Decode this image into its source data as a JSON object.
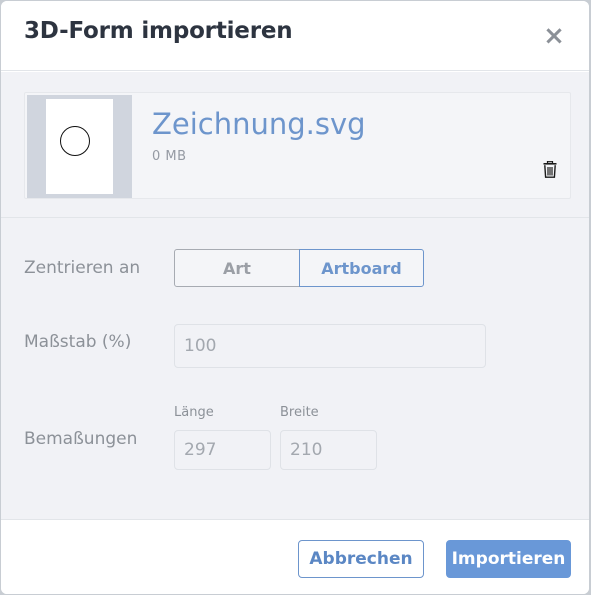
{
  "dialog": {
    "title": "3D-Form importieren",
    "close_icon": "×"
  },
  "file": {
    "name": "Zeichnung.svg",
    "size": "0 MB"
  },
  "options": {
    "center_label": "Zentrieren an",
    "center_options": [
      "Art",
      "Artboard"
    ],
    "center_selected": "Artboard",
    "scale_label": "Maßstab (%)",
    "scale_value": "100",
    "dimensions_label": "Bemaßungen",
    "length_label": "Länge",
    "length_value": "297",
    "width_label": "Breite",
    "width_value": "210"
  },
  "footer": {
    "cancel_label": "Abbrechen",
    "import_label": "Importieren"
  },
  "colors": {
    "accent": "#6d95cc",
    "primary_button": "#6998d8",
    "body_bg": "#f1f2f6"
  },
  "icons": {
    "close": "close-icon",
    "delete": "trash-icon"
  }
}
